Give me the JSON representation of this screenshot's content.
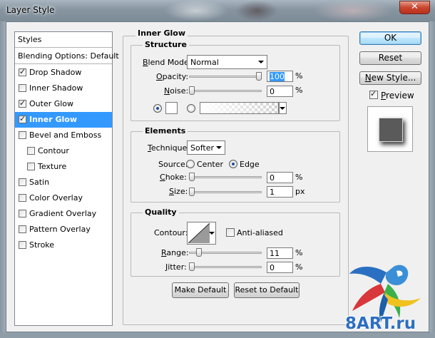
{
  "window": {
    "title": "Layer Style",
    "close_symbol": "✕"
  },
  "style_list": {
    "styles_header": "Styles",
    "blending_options": "Blending Options: Default",
    "items": [
      {
        "label": "Drop Shadow",
        "checked": true
      },
      {
        "label": "Inner Shadow",
        "checked": false
      },
      {
        "label": "Outer Glow",
        "checked": true
      },
      {
        "label": "Inner Glow",
        "checked": true,
        "selected": true
      },
      {
        "label": "Bevel and Emboss",
        "checked": false
      },
      {
        "label": "Contour",
        "checked": false,
        "indented": true
      },
      {
        "label": "Texture",
        "checked": false,
        "indented": true
      },
      {
        "label": "Satin",
        "checked": false
      },
      {
        "label": "Color Overlay",
        "checked": false
      },
      {
        "label": "Gradient Overlay",
        "checked": false
      },
      {
        "label": "Pattern Overlay",
        "checked": false
      },
      {
        "label": "Stroke",
        "checked": false
      }
    ]
  },
  "panel": {
    "title": "Inner Glow",
    "structure": {
      "title": "Structure",
      "blend_mode_label": "Blend Mode:",
      "blend_mode_value": "Normal",
      "opacity_label": "Opacity:",
      "opacity_value": "100",
      "opacity_level": 1.0,
      "noise_label": "Noise:",
      "noise_value": "0",
      "noise_level": 0.0,
      "percent": "%"
    },
    "elements": {
      "title": "Elements",
      "technique_label": "Technique:",
      "technique_value": "Softer",
      "source_label": "Source:",
      "source_center": "Center",
      "source_edge": "Edge",
      "source_selected": "Edge",
      "choke_label": "Choke:",
      "choke_value": "0",
      "choke_level": 0.0,
      "size_label": "Size:",
      "size_value": "1",
      "size_level": 0.0,
      "percent": "%",
      "px": "px"
    },
    "quality": {
      "title": "Quality",
      "contour_label": "Contour:",
      "anti_aliased_label": "Anti-aliased",
      "anti_aliased": false,
      "range_label": "Range:",
      "range_value": "11",
      "range_level": 0.11,
      "jitter_label": "Jitter:",
      "jitter_value": "0",
      "jitter_level": 0.0,
      "percent": "%"
    },
    "make_default": "Make Default",
    "reset_to_default": "Reset to Default"
  },
  "buttons": {
    "ok": "OK",
    "reset": "Reset",
    "new_style": "New Style...",
    "preview_label": "Preview",
    "preview_checked": true
  },
  "watermark": {
    "text": "8ART.ru"
  },
  "colors": {
    "selection": "#3399ff",
    "ok_button": "#bee6fd",
    "close_button": "#c9462f"
  }
}
